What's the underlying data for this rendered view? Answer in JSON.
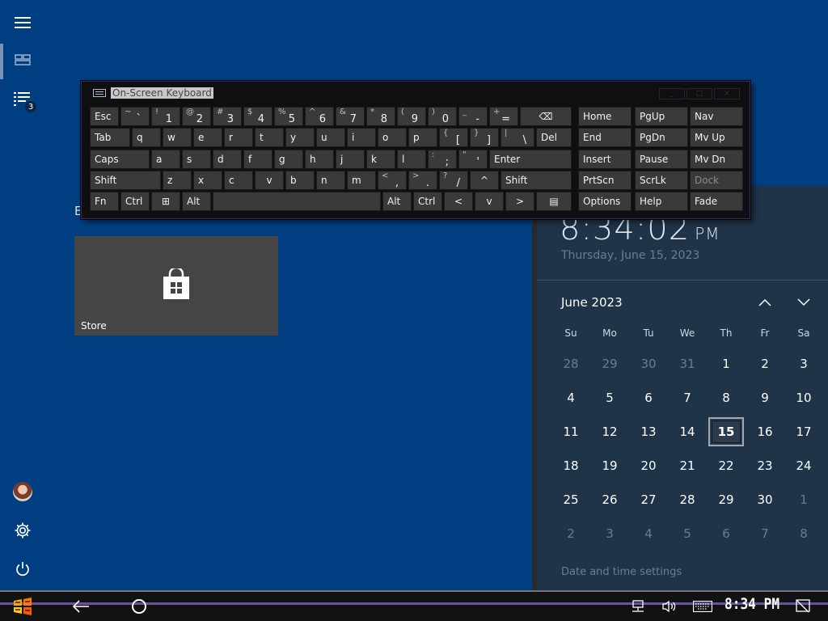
{
  "start": {
    "section_letter": "E",
    "tiles": [
      {
        "label": "Store",
        "icon": "store-bag-icon"
      }
    ],
    "rail_icons": [
      "hamburger-menu-icon",
      "all-tiles-icon",
      "all-apps-list-icon",
      "user-avatar",
      "settings-gear-icon",
      "power-icon"
    ],
    "apps_badge": "3"
  },
  "osk": {
    "title": "On-Screen Keyboard",
    "controls": [
      "_",
      "□",
      "×"
    ],
    "keys": [
      [
        {
          "l": "Esc"
        },
        {
          "s": "~",
          "l": "`"
        },
        {
          "s": "!",
          "l": "1"
        },
        {
          "s": "@",
          "l": "2"
        },
        {
          "s": "#",
          "l": "3"
        },
        {
          "s": "$",
          "l": "4"
        },
        {
          "s": "%",
          "l": "5"
        },
        {
          "s": "^",
          "l": "6"
        },
        {
          "s": "&",
          "l": "7"
        },
        {
          "s": "*",
          "l": "8"
        },
        {
          "s": "(",
          "l": "9"
        },
        {
          "s": ")",
          "l": "0"
        },
        {
          "s": "_",
          "l": "-"
        },
        {
          "s": "+",
          "l": "="
        },
        {
          "l": "⌫"
        },
        {
          "l": "Home"
        },
        {
          "l": "PgUp"
        },
        {
          "l": "Nav"
        }
      ],
      [
        {
          "l": "Tab"
        },
        {
          "l": "q"
        },
        {
          "l": "w"
        },
        {
          "l": "e"
        },
        {
          "l": "r"
        },
        {
          "l": "t"
        },
        {
          "l": "y"
        },
        {
          "l": "u"
        },
        {
          "l": "i"
        },
        {
          "l": "o"
        },
        {
          "l": "p"
        },
        {
          "s": "{",
          "l": "["
        },
        {
          "s": "}",
          "l": "]"
        },
        {
          "s": "|",
          "l": "\\"
        },
        {
          "l": "Del"
        },
        {
          "l": "End"
        },
        {
          "l": "PgDn"
        },
        {
          "l": "Mv Up"
        }
      ],
      [
        {
          "l": "Caps"
        },
        {
          "l": "a"
        },
        {
          "l": "s"
        },
        {
          "l": "d"
        },
        {
          "l": "f"
        },
        {
          "l": "g"
        },
        {
          "l": "h"
        },
        {
          "l": "j"
        },
        {
          "l": "k"
        },
        {
          "l": "l"
        },
        {
          "s": ":",
          "l": ";"
        },
        {
          "s": "\"",
          "l": "'"
        },
        {
          "l": "Enter"
        },
        {
          "l": "Insert"
        },
        {
          "l": "Pause"
        },
        {
          "l": "Mv Dn"
        }
      ],
      [
        {
          "l": "Shift"
        },
        {
          "l": "z"
        },
        {
          "l": "x"
        },
        {
          "l": "c"
        },
        {
          "l": "v"
        },
        {
          "l": "b"
        },
        {
          "l": "n"
        },
        {
          "l": "m"
        },
        {
          "s": "<",
          "l": ","
        },
        {
          "s": ">",
          "l": "."
        },
        {
          "s": "?",
          "l": "/"
        },
        {
          "l": "^"
        },
        {
          "l": "Shift"
        },
        {
          "l": "PrtScn"
        },
        {
          "l": "ScrLk"
        },
        {
          "l": "Dock"
        }
      ],
      [
        {
          "l": "Fn"
        },
        {
          "l": "Ctrl"
        },
        {
          "l": "⊞"
        },
        {
          "l": "Alt"
        },
        {
          "l": ""
        },
        {
          "l": "Alt"
        },
        {
          "l": "Ctrl"
        },
        {
          "l": "<"
        },
        {
          "l": "v"
        },
        {
          "l": ">"
        },
        {
          "l": "▤"
        },
        {
          "l": "Options"
        },
        {
          "l": "Help"
        },
        {
          "l": "Fade"
        }
      ]
    ]
  },
  "calendar": {
    "time": "8:34:02",
    "ampm": "PM",
    "date_long": "Thursday, June 15, 2023",
    "month_label": "June 2023",
    "weekdays": [
      "Su",
      "Mo",
      "Tu",
      "We",
      "Th",
      "Fr",
      "Sa"
    ],
    "days": [
      "28",
      "29",
      "30",
      "31",
      "1",
      "2",
      "3",
      "4",
      "5",
      "6",
      "7",
      "8",
      "9",
      "10",
      "11",
      "12",
      "13",
      "14",
      "15",
      "16",
      "17",
      "18",
      "19",
      "20",
      "21",
      "22",
      "23",
      "24",
      "25",
      "26",
      "27",
      "28",
      "29",
      "30",
      "1",
      "2",
      "3",
      "4",
      "5",
      "6",
      "7",
      "8"
    ],
    "today": "15",
    "settings_link": "Date and time settings"
  },
  "taskbar": {
    "clock": "8:34 PM",
    "items": [
      "start-logo-icon",
      "back-arrow-icon",
      "cortana-circle-icon",
      "network-icon",
      "volume-icon",
      "keyboard-icon",
      "notification-icon"
    ]
  }
}
